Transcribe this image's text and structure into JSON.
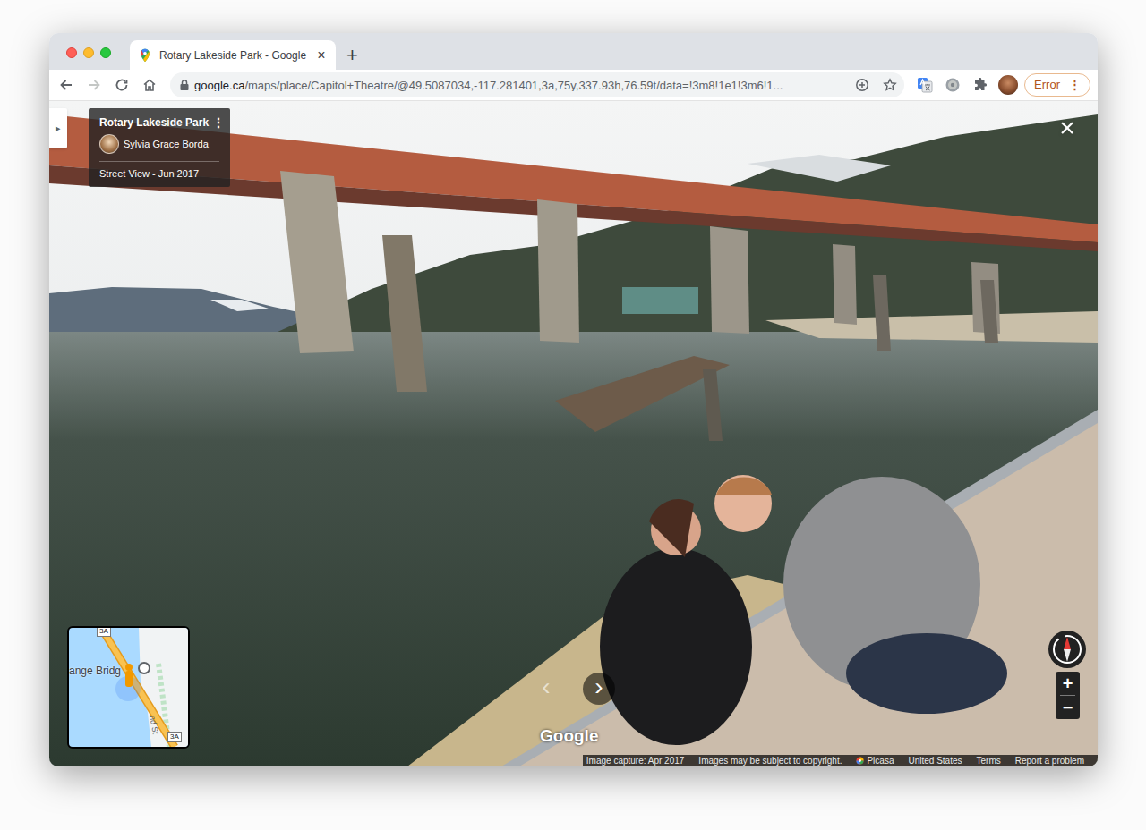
{
  "browser": {
    "tabs": [
      {
        "title": "Rotary Lakeside Park - Google",
        "close": "×",
        "selected": true
      }
    ],
    "new_tab": "+",
    "nav": {
      "back": {
        "disabled": false
      },
      "forward": {
        "disabled": true
      }
    },
    "url": {
      "host": "google.ca",
      "rest": "/maps/place/Capitol+Theatre/@49.5087034,-117.281401,3a,75y,337.93h,76.59t/data=!3m8!1e1!3m6!1..."
    },
    "profile": {
      "label": "Error",
      "menu": "⋮"
    }
  },
  "panel_toggle": "▸",
  "place_card": {
    "title": "Rotary Lakeside Park",
    "author": "Sylvia Grace Borda",
    "source": "Street View - Jun 2017",
    "menu": "⋮"
  },
  "close": "×",
  "zoom": {
    "in": "+",
    "out": "−"
  },
  "nav_arrows": [
    {
      "glyph": "‹",
      "highlighted": false
    },
    {
      "glyph": "›",
      "highlighted": true
    }
  ],
  "logo": "Google",
  "minimap": {
    "label": "ange Bridg",
    "shields": [
      "3A",
      "3A"
    ],
    "street": "nd St"
  },
  "footer": {
    "capture": "Image capture: Apr 2017",
    "copyright": "Images may be subject to copyright.",
    "source": "Picasa",
    "region": "United States",
    "terms": "Terms",
    "report": "Report a problem"
  }
}
